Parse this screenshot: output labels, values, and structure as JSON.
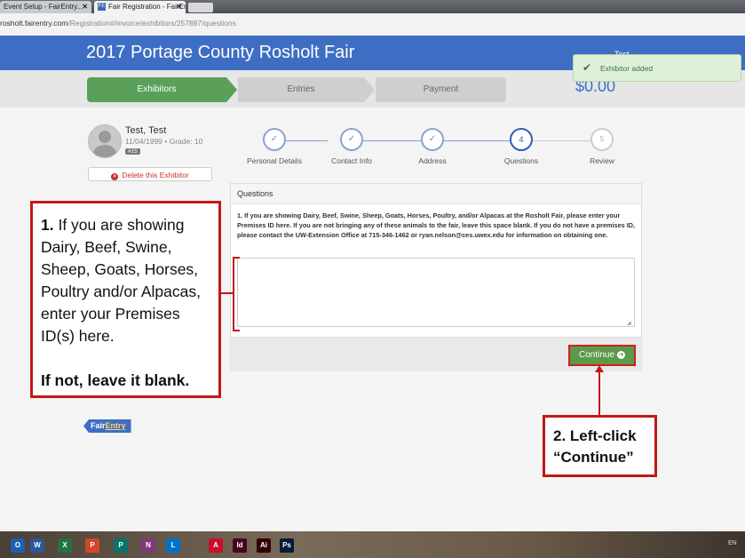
{
  "browser": {
    "tabs": [
      {
        "label": "Event Setup - FairEntry..."
      },
      {
        "label": "Fair Registration - FairEn..."
      }
    ],
    "tab_close": "✕",
    "active_tab_icon": "FE",
    "url_host": "rosholt.fairentry.com",
    "url_path": "/Registration#/invoice/exhibitors/257887/questions"
  },
  "header": {
    "title": "2017 Portage County Rosholt Fair",
    "user": "Test ..."
  },
  "progress": {
    "steps": [
      {
        "label": "Exhibitors"
      },
      {
        "label": "Entries"
      },
      {
        "label": "Payment"
      }
    ],
    "total": "$0.00"
  },
  "toast": {
    "text": "Exhibitor added"
  },
  "exhibitor": {
    "name": "Test, Test",
    "meta": "11/04/1999 • Grade: 10",
    "badge": "#15",
    "delete_label": "Delete this Exhibitor"
  },
  "wizard": {
    "steps": [
      {
        "label": "Personal Details",
        "marker": "✓"
      },
      {
        "label": "Contact Info",
        "marker": "✓"
      },
      {
        "label": "Address",
        "marker": "✓"
      },
      {
        "label": "Questions",
        "marker": "4"
      },
      {
        "label": "Review",
        "marker": "5"
      }
    ]
  },
  "questions": {
    "panel_title": "Questions",
    "question_text": "1. If you are showing Dairy, Beef, Swine, Sheep, Goats, Horses, Poultry, and/or Alpacas at the Rosholt Fair, please enter your Premises ID here. If you are not bringing any of these animals to the fair, leave this space blank. If you do not have a premises ID, please contact the UW-Extension Office at 715-346-1462 or ryan.nelson@ces.uwex.edu for information on obtaining one.",
    "answer_value": "",
    "continue_label": "Continue"
  },
  "footer": {
    "logo_prefix": "Fair",
    "logo_suffix": "Entry"
  },
  "callouts": {
    "step1_number": "1.",
    "step1_text": " If you are showing Dairy, Beef, Swine, Sheep, Goats, Horses, Poultry and/or Alpacas, enter your Premises ID(s) here.",
    "step1_note": "If not, leave it blank.",
    "step2_line1": "2. Left-click",
    "step2_line2": "“Continue”"
  },
  "taskbar": {
    "icons": [
      {
        "name": "outlook-icon",
        "glyph": "O",
        "color": "#1f5fb0"
      },
      {
        "name": "word-icon",
        "glyph": "W",
        "color": "#2b579a"
      },
      {
        "name": "excel-icon",
        "glyph": "X",
        "color": "#217346"
      },
      {
        "name": "powerpoint-icon",
        "glyph": "P",
        "color": "#d24726"
      },
      {
        "name": "publisher-icon",
        "glyph": "P",
        "color": "#077568"
      },
      {
        "name": "onenote-icon",
        "glyph": "N",
        "color": "#80397b"
      },
      {
        "name": "lync-icon",
        "glyph": "L",
        "color": "#0072c6"
      },
      {
        "name": "acrobat-icon",
        "glyph": "A",
        "color": "#c8102e"
      },
      {
        "name": "indesign-icon",
        "glyph": "Id",
        "color": "#49021f"
      },
      {
        "name": "illustrator-icon",
        "glyph": "Ai",
        "color": "#330000"
      },
      {
        "name": "photoshop-icon",
        "glyph": "Ps",
        "color": "#001e36"
      }
    ],
    "lang": "EN"
  }
}
